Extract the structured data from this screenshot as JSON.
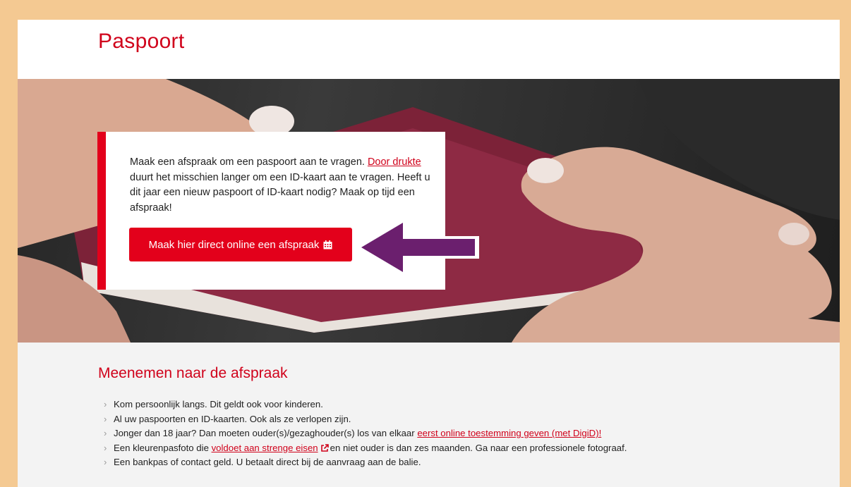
{
  "page": {
    "title": "Paspoort"
  },
  "hero": {
    "text_1": "Maak een afspraak om een paspoort aan te vragen. ",
    "link": "Door drukte",
    "text_2": " duurt het misschien langer om een ID-kaart aan te vragen. Heeft u dit jaar een nieuw paspoort of ID-kaart nodig? Maak op tijd een afspraak!",
    "button_label": "Maak hier direct online een afspraak",
    "button_icon": "calendar-icon",
    "arrow_icon": "arrow-left-icon"
  },
  "section": {
    "title": "Meenemen naar de afspraak",
    "items": [
      {
        "text": "Kom persoonlijk langs. Dit geldt ook voor kinderen."
      },
      {
        "text": "Al uw paspoorten en ID-kaarten. Ook als ze verlopen zijn."
      },
      {
        "text": "Jonger dan 18 jaar? Dan moeten ouder(s)/gezaghouder(s) los van elkaar ",
        "link": "eerst online toestemming geven (met DigiD)!"
      },
      {
        "text": "Een kleurenpasfoto die ",
        "link": "voldoet aan strenge eisen",
        "after": " en niet ouder is dan zes maanden. Ga naar een professionele fotograaf."
      },
      {
        "text": "Een bankpas of contact geld. U betaalt direct bij de aanvraag aan de balie."
      }
    ]
  },
  "colors": {
    "accent": "#e3001b",
    "frame": "#f4c992",
    "arrow": "#6b1f6e"
  }
}
